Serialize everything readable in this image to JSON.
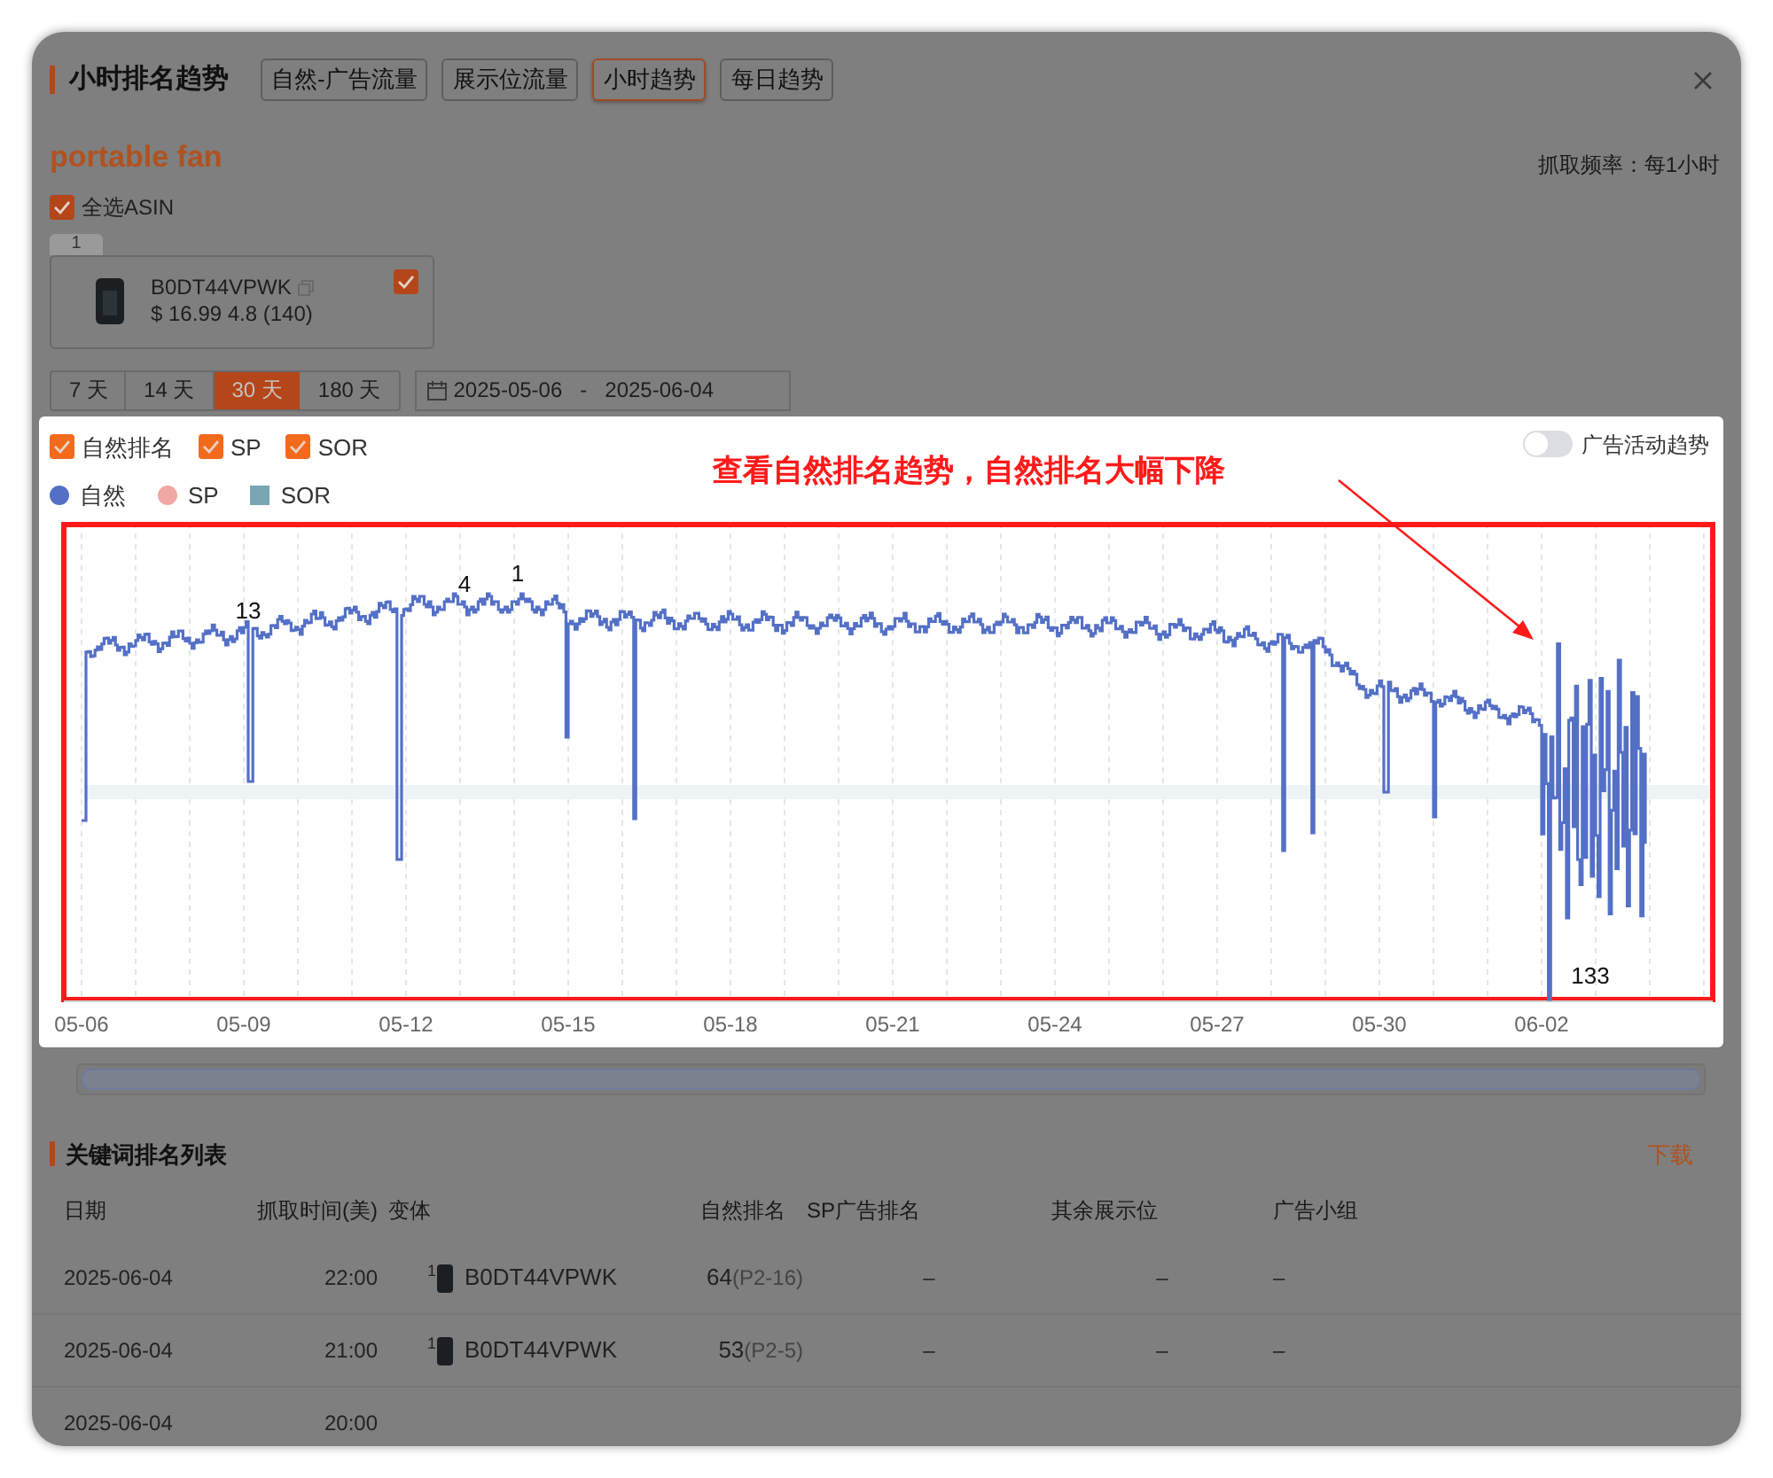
{
  "dialog": {
    "title": "小时排名趋势",
    "tabs": [
      {
        "label": "自然-广告流量",
        "selected": false
      },
      {
        "label": "展示位流量",
        "selected": false
      },
      {
        "label": "小时趋势",
        "selected": true
      },
      {
        "label": "每日趋势",
        "selected": false
      }
    ],
    "keyword": "portable fan",
    "frequency": "抓取频率：每1小时"
  },
  "select_all": {
    "label": "全选ASIN",
    "checked": true
  },
  "asins": [
    {
      "index": "1",
      "asin": "B0DT44VPWK",
      "details": "$ 16.99 4.8 (140)",
      "checked": true
    }
  ],
  "ranges": [
    {
      "label": "7 天",
      "selected": false
    },
    {
      "label": "14 天",
      "selected": false
    },
    {
      "label": "30 天",
      "selected": true
    },
    {
      "label": "180 天",
      "selected": false
    }
  ],
  "date_range": {
    "start": "2025-05-06",
    "separator": "-",
    "end": "2025-06-04"
  },
  "chart": {
    "series_toggles": [
      {
        "label": "自然排名",
        "checked": true
      },
      {
        "label": "SP",
        "checked": true
      },
      {
        "label": "SOR",
        "checked": true
      }
    ],
    "legend": [
      {
        "label": "自然",
        "kind": "dot",
        "color": "#5470c6"
      },
      {
        "label": "SP",
        "kind": "dot",
        "color": "#f0a8a4"
      },
      {
        "label": "SOR",
        "kind": "square",
        "color": "#7aa6b4"
      }
    ],
    "ad_trend": {
      "label": "广告活动趋势",
      "on": false
    },
    "note": "查看自然排名趋势，自然排名大幅下降",
    "point_labels": [
      "13",
      "4",
      "1",
      "133"
    ],
    "x_labels": [
      "05-06",
      "05-09",
      "05-12",
      "05-15",
      "05-18",
      "05-21",
      "05-24",
      "05-27",
      "05-30",
      "06-02"
    ]
  },
  "data_zoom": {
    "level": 1
  },
  "keyword_table": {
    "title": "关键词排名列表",
    "download": "下载",
    "columns": [
      "日期",
      "抓取时间(美)",
      "变体",
      "自然排名",
      "SP广告排名",
      "其余展示位",
      "广告小组"
    ],
    "rows": [
      {
        "date": "2025-06-04",
        "time": "22:00",
        "variant_index": "1",
        "asin": "B0DT44VPWK",
        "rank": "64",
        "page_pos": "(P2-16)",
        "sp_rank": "–",
        "other": "–",
        "ad_group": "–"
      },
      {
        "date": "2025-06-04",
        "time": "21:00",
        "variant_index": "1",
        "asin": "B0DT44VPWK",
        "rank": "53",
        "page_pos": "(P2-5)",
        "sp_rank": "–",
        "other": "–",
        "ad_group": "–"
      },
      {
        "date": "2025-06-04",
        "time": "20:00"
      }
    ]
  }
}
